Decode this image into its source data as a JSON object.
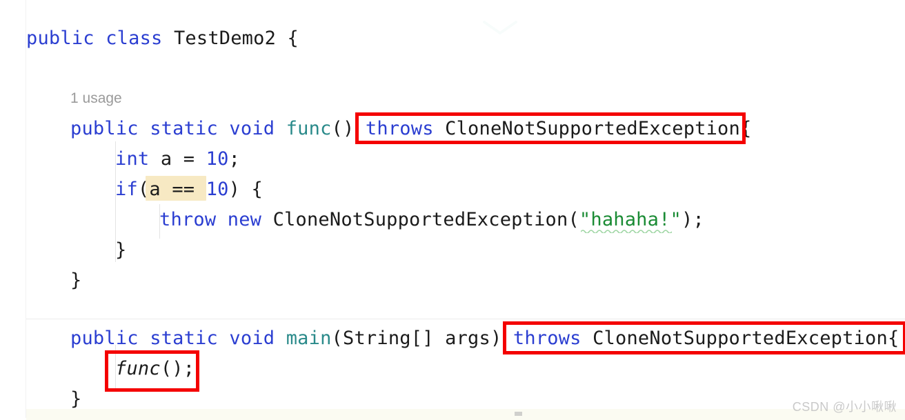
{
  "editor": {
    "background_color": "#ffffff",
    "font_size_px": 27,
    "colors": {
      "keyword": "#2b3ed1",
      "number": "#2b3ed1",
      "method": "#2a8a8a",
      "string": "#1a8b34",
      "plain": "#1b1b1b",
      "usage_hint": "#9a9a9a",
      "token_highlight": "#f7e9c3",
      "annotation_box": "#f40000",
      "indent_guide": "#e3e3e3",
      "separator": "#ececec"
    },
    "code": {
      "line1": {
        "kw_public": "public",
        "space1": " ",
        "kw_class": "class",
        "space2": " ",
        "class_name": "TestDemo2",
        "space3": " ",
        "brace": "{"
      },
      "usage_hint": "1 usage",
      "line2": {
        "kw_public": "public",
        "space1": " ",
        "kw_static": "static",
        "space2": " ",
        "kw_void": "void",
        "space3": " ",
        "method_name": "func",
        "parens": "()",
        "space4": " ",
        "kw_throws": "throws",
        "space5": " ",
        "exception_type": "CloneNotSupportedException",
        "brace": "{"
      },
      "line3": {
        "kw_int": "int",
        "rest_a": " a = ",
        "number": "10",
        "semicolon": ";"
      },
      "line4": {
        "kw_if": "if",
        "paren_open": "(",
        "var": "a",
        "operator": " == ",
        "number": "10",
        "paren_close": ")",
        "brace": " {"
      },
      "line5": {
        "kw_throw": "throw",
        "space1": " ",
        "kw_new": "new",
        "space2": " ",
        "exception_type": "CloneNotSupportedException",
        "paren_open": "(",
        "string": "\"hahaha!\"",
        "paren_close": ")",
        "semicolon": ";"
      },
      "line6": {
        "brace": "}"
      },
      "line7": {
        "brace": "}"
      },
      "line8": {
        "kw_public": "public",
        "space1": " ",
        "kw_static": "static",
        "space2": " ",
        "kw_void": "void",
        "space3": " ",
        "method_name": "main",
        "paren_open": "(",
        "param_type": "String[]",
        "space4": " ",
        "param_name": "args",
        "paren_close": ")",
        "space5": " ",
        "kw_throws": "throws",
        "space6": " ",
        "exception_type": "CloneNotSupportedException",
        "brace": "{"
      },
      "line9": {
        "call": "func",
        "parens": "()",
        "semicolon": ";"
      },
      "line10": {
        "brace": "}"
      }
    }
  },
  "annotations": {
    "box1_target": "throws CloneNotSupportedException{",
    "box2_target": "throws CloneNotSupportedException{",
    "box3_target": "func();"
  },
  "watermark": {
    "text": "CSDN @小小啾啾"
  }
}
